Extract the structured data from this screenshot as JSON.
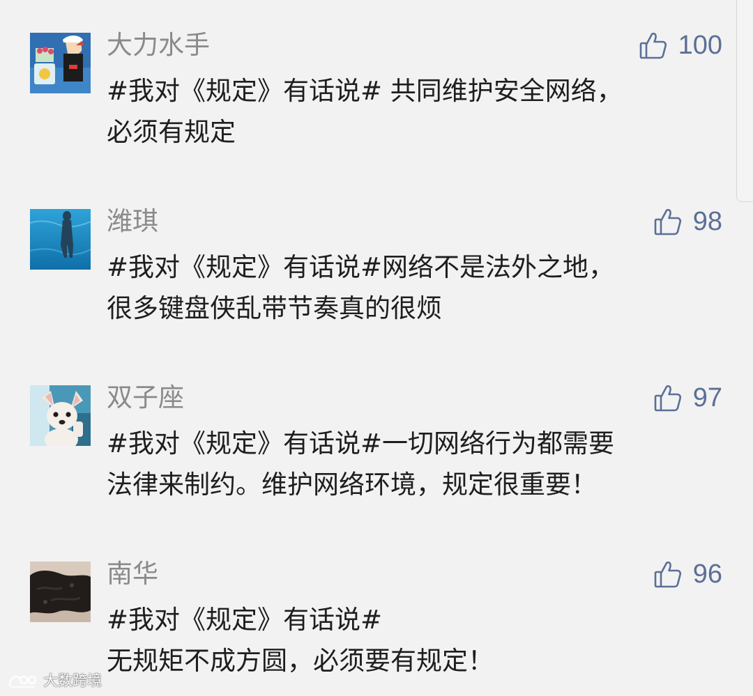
{
  "colors": {
    "background": "#f2f2f2",
    "username": "#8a8a8a",
    "comment_text": "#1e1e1e",
    "like_accent": "#5b6f96"
  },
  "comments": [
    {
      "username": "大力水手",
      "likes": "100",
      "text_line1": "#我对《规定》有话说# 共同维护安全网络，",
      "text_line2": "必须有规定",
      "avatar_icon": "popeye-avatar",
      "like_icon": "thumbs-up-icon"
    },
    {
      "username": "潍琪",
      "likes": "98",
      "text_line1": "#我对《规定》有话说#网络不是法外之地，",
      "text_line2": "很多键盘侠乱带节奏真的很烦",
      "avatar_icon": "underwater-avatar",
      "like_icon": "thumbs-up-icon"
    },
    {
      "username": "双子座",
      "likes": "97",
      "text_line1": "#我对《规定》有话说#一切网络行为都需要",
      "text_line2": "法律来制约。维护网络环境，规定很重要！",
      "avatar_icon": "puppy-avatar",
      "like_icon": "thumbs-up-icon"
    },
    {
      "username": "南华",
      "likes": "96",
      "text_line1": "#我对《规定》有话说#",
      "text_line2": "无规矩不成方圆，必须要有规定！",
      "avatar_icon": "dark-fur-avatar",
      "like_icon": "thumbs-up-icon"
    }
  ],
  "watermark": {
    "text": "大数跨境",
    "icon": "watermark-logo-icon"
  }
}
